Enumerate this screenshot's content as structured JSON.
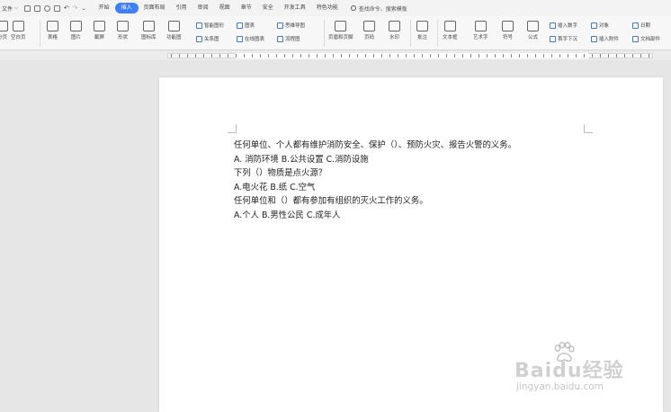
{
  "menubar": {
    "file_label": "文件",
    "tabs": [
      {
        "label": "开始"
      },
      {
        "label": "插入"
      },
      {
        "label": "页面布局"
      },
      {
        "label": "引用"
      },
      {
        "label": "审阅"
      },
      {
        "label": "视图"
      },
      {
        "label": "章节"
      },
      {
        "label": "安全"
      },
      {
        "label": "开发工具"
      },
      {
        "label": "特色功能"
      }
    ],
    "active_tab": "插入",
    "search_placeholder": "查找命令、搜索模板"
  },
  "ribbon": {
    "large": [
      {
        "label": "分页"
      },
      {
        "label": "空白页"
      },
      {
        "label": "表格"
      },
      {
        "label": "图片"
      },
      {
        "label": "截屏"
      },
      {
        "label": "形状"
      },
      {
        "label": "图标库"
      },
      {
        "label": "功能图"
      },
      {
        "label": "页眉和页脚"
      },
      {
        "label": "页码"
      },
      {
        "label": "水印"
      },
      {
        "label": "批注"
      },
      {
        "label": "文本框"
      },
      {
        "label": "艺术字"
      },
      {
        "label": "符号"
      },
      {
        "label": "公式"
      }
    ],
    "small": [
      {
        "label": "智能图形"
      },
      {
        "label": "关系图"
      },
      {
        "label": "图表"
      },
      {
        "label": "在线图表"
      },
      {
        "label": "思维导图"
      },
      {
        "label": "流程图"
      },
      {
        "label": "插入数字"
      },
      {
        "label": "首字下沉"
      },
      {
        "label": "对象"
      },
      {
        "label": "插入附件"
      },
      {
        "label": "日期"
      },
      {
        "label": "文档部件"
      }
    ]
  },
  "document": {
    "lines": [
      "任何单位、个人都有维护消防安全、保护（）、预防火灾、报告火警的义务。",
      "A. 消防环境    B.公共设置    C.消防设施",
      "下列（）物质是点火源？",
      "A.电火花    B.纸    C.空气",
      "任何单位和（）都有参加有组织的灭火工作的义务。",
      "A.个人    B.男性公民    C.成年人"
    ]
  },
  "watermark": {
    "brand": "Baidu经验",
    "url": "jingyan.baidu.com"
  },
  "colors": {
    "accent": "#3e7ff3",
    "page": "#ffffff",
    "workspace": "#e6e6e6"
  }
}
